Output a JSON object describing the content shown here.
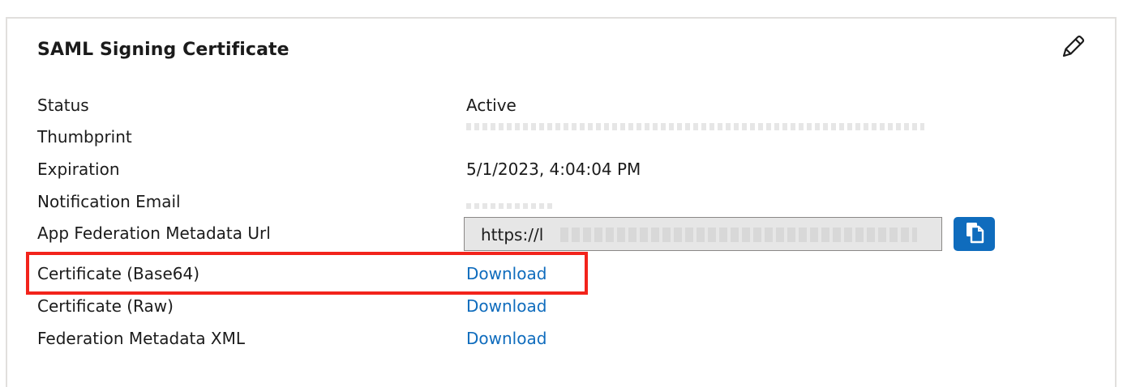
{
  "card": {
    "title": "SAML Signing Certificate",
    "edit_icon": "pencil-icon"
  },
  "rows": {
    "status": {
      "label": "Status",
      "value": "Active"
    },
    "thumbprint": {
      "label": "Thumbprint"
    },
    "expiration": {
      "label": "Expiration",
      "value": "5/1/2023, 4:04:04 PM"
    },
    "notification_email": {
      "label": "Notification Email"
    },
    "app_federation_metadata_url": {
      "label": "App Federation Metadata Url",
      "value_prefix": "https://l",
      "copy_icon": "copy-icon"
    },
    "certificate_base64": {
      "label": "Certificate (Base64)",
      "link": "Download"
    },
    "certificate_raw": {
      "label": "Certificate (Raw)",
      "link": "Download"
    },
    "federation_metadata_xml": {
      "label": "Federation Metadata XML",
      "link": "Download"
    }
  },
  "colors": {
    "link": "#0f6cbd",
    "copy_button": "#0f6cbd",
    "highlight": "#f2231b",
    "card_border": "#e1dfdd"
  }
}
